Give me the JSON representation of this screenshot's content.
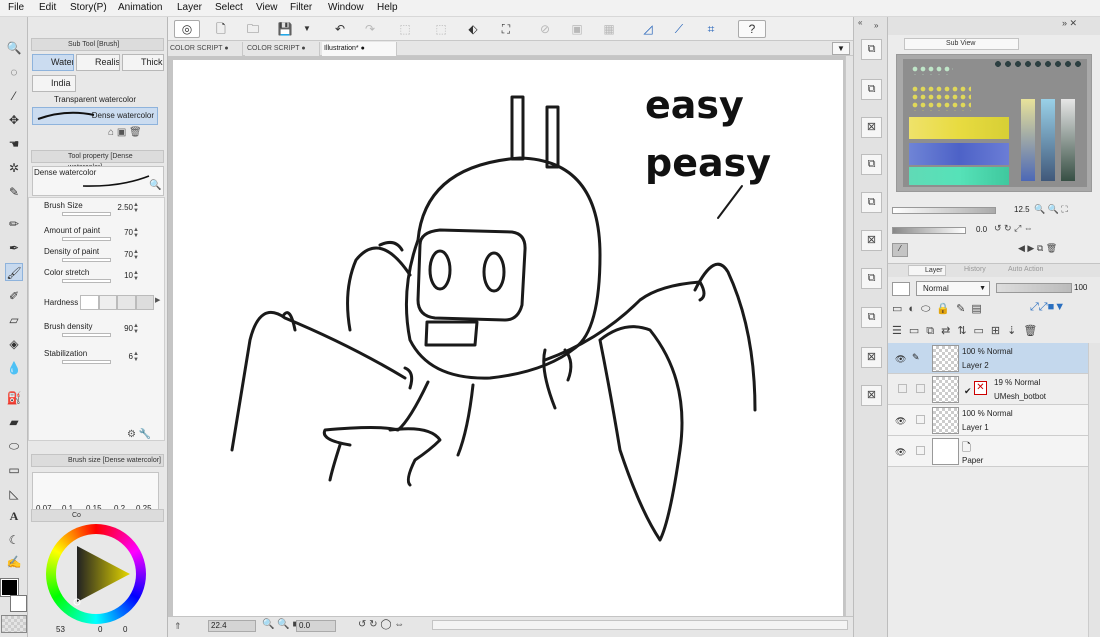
{
  "menu": [
    "File",
    "Edit",
    "Story(P)",
    "Animation",
    "Layer",
    "Select",
    "View",
    "Filter",
    "Window",
    "Help"
  ],
  "subtool_panel": {
    "title": "Sub Tool [Brush]",
    "tabs": [
      "Water",
      "Realis",
      "Thick",
      "India"
    ],
    "brushes": [
      "Transparent watercolor",
      "Dense watercolor"
    ]
  },
  "tool_property": {
    "title": "Tool property [Dense watercolor]",
    "brush_name": "Dense watercolor",
    "props": [
      {
        "label": "Brush Size",
        "value": "2.50"
      },
      {
        "label": "Amount of paint",
        "value": "70"
      },
      {
        "label": "Density of paint",
        "value": "70"
      },
      {
        "label": "Color stretch",
        "value": "10"
      },
      {
        "label": "Hardness",
        "value": ""
      },
      {
        "label": "Brush density",
        "value": "90"
      },
      {
        "label": "Stabilization",
        "value": "6"
      }
    ]
  },
  "brush_size_panel": {
    "title": "Brush size [Dense watercolor]",
    "sizes": [
      "0.07",
      "0.1",
      "0.15",
      "0.2",
      "0.25"
    ]
  },
  "color_panel": {
    "tab_label": "Co",
    "values": [
      "53",
      "0",
      "0"
    ]
  },
  "colors": {
    "main": "#000000",
    "sub": "#ffffff",
    "selection": "#c4d8ed"
  },
  "doc_tabs": [
    "COLOR SCRIPT",
    "COLOR SCRIPT",
    "Illustration*"
  ],
  "status": {
    "zoom": "22.4",
    "angle": "0.0"
  },
  "subview": {
    "tabs": [
      "Sub View"
    ],
    "zoom": "12.5",
    "rotation": "0.0"
  },
  "layer_panel": {
    "tabs": [
      "Layer",
      "History",
      "Auto Action"
    ],
    "blend_mode": "Normal",
    "opacity": "100",
    "layers": [
      {
        "opacity": "100 % Normal",
        "name": "Layer 2"
      },
      {
        "opacity": "19 % Normal",
        "name": "UMesh_botbot"
      },
      {
        "opacity": "100 % Normal",
        "name": "Layer 1"
      },
      {
        "opacity": "",
        "name": "Paper"
      }
    ]
  },
  "canvas_text": {
    "line1": "easy",
    "line2": "peasy"
  }
}
